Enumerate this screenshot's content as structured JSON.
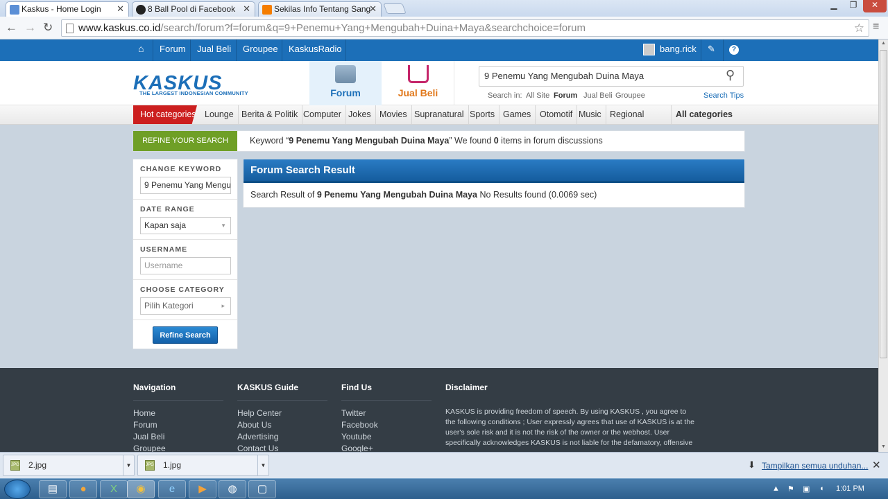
{
  "browser": {
    "tabs": [
      {
        "title": "Kaskus - Home Login",
        "active": true
      },
      {
        "title": "8 Ball Pool di Facebook",
        "active": false
      },
      {
        "title": "Sekilas Info Tentang Sang",
        "active": false
      }
    ],
    "url_host": "www.kaskus.co.id",
    "url_path": "/search/forum?f=forum&q=9+Penemu+Yang+Mengubah+Duina+Maya&searchchoice=forum"
  },
  "topnav": {
    "links": [
      "Forum",
      "Jual Beli",
      "Groupee",
      "KaskusRadio"
    ],
    "username": "bang.rick"
  },
  "header": {
    "logo_text": "KASKUS",
    "logo_tagline": "THE LARGEST INDONESIAN COMMUNITY",
    "forum_tab": "Forum",
    "jualbeli_tab": "Jual Beli",
    "search_value": "9 Penemu Yang Mengubah Duina Maya",
    "search_in_label": "Search in:",
    "search_in_options": [
      "All Site",
      "Forum",
      "Jual Beli",
      "Groupee"
    ],
    "search_tips": "Search Tips"
  },
  "categories": {
    "hot": "Hot categories",
    "items": [
      "Lounge",
      "Berita & Politik",
      "Computer",
      "Jokes",
      "Movies",
      "Supranatural",
      "Sports",
      "Games",
      "Otomotif",
      "Music",
      "Regional"
    ],
    "all": "All categories"
  },
  "refine": {
    "label": "REFINE YOUR SEARCH",
    "keyword_prefix": "Keyword “",
    "keyword": "9 Penemu Yang Mengubah Duina Maya",
    "keyword_mid": "” We found ",
    "count": "0",
    "keyword_suffix": " items in forum discussions"
  },
  "sidebar": {
    "change_keyword_label": "CHANGE KEYWORD",
    "keyword_value": "9 Penemu Yang Mengubah Duina Maya",
    "date_range_label": "DATE RANGE",
    "date_range_value": "Kapan saja",
    "username_label": "USERNAME",
    "username_placeholder": "Username",
    "category_label": "CHOOSE CATEGORY",
    "category_value": "Pilih Kategori",
    "refine_button": "Refine Search"
  },
  "results": {
    "title": "Forum Search Result",
    "prefix": "Search Result of ",
    "query": "9 Penemu Yang Mengubah Duina Maya",
    "suffix": " No Results found (0.0069 sec)"
  },
  "footer": {
    "navigation": {
      "title": "Navigation",
      "links": [
        "Home",
        "Forum",
        "Jual Beli",
        "Groupee"
      ]
    },
    "guide": {
      "title": "KASKUS Guide",
      "links": [
        "Help Center",
        "About Us",
        "Advertising",
        "Contact Us"
      ]
    },
    "findus": {
      "title": "Find Us",
      "links": [
        "Twitter",
        "Facebook",
        "Youtube",
        "Google+"
      ]
    },
    "disclaimer": {
      "title": "Disclaimer",
      "text": "KASKUS is providing freedom of speech. By using KASKUS , you agree to the following conditions ; User expressly agrees that use of KASKUS is at the user's sole risk and it is not the risk of the owner or the webhost. User specifically acknowledges KASKUS is not liable for the defamatory, offensive"
    }
  },
  "downloads": {
    "items": [
      "2.jpg",
      "1.jpg"
    ],
    "show_all": "Tampilkan semua unduhan..."
  },
  "taskbar": {
    "clock": "1:01 PM"
  }
}
